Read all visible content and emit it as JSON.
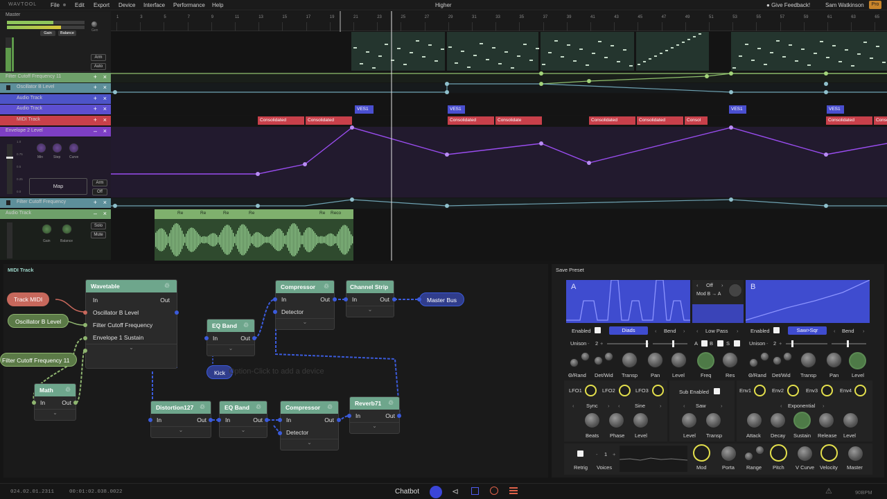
{
  "app": {
    "logo": "WAVTOOL",
    "title": "Higher",
    "feedback": "Give Feedback!",
    "user": "Sam Watkinson",
    "plan": "Pro"
  },
  "menu": [
    "File",
    "Edit",
    "Export",
    "Device",
    "Interface",
    "Performance",
    "Help"
  ],
  "ruler": [
    "1",
    "3",
    "5",
    "7",
    "9",
    "11",
    "13",
    "15",
    "17",
    "19",
    "21",
    "23",
    "25",
    "27",
    "29",
    "31",
    "33",
    "35",
    "37",
    "39",
    "41",
    "43",
    "45",
    "47",
    "49",
    "51",
    "53",
    "55",
    "57",
    "59",
    "61",
    "63",
    "65"
  ],
  "tracks": {
    "master": {
      "name": "Master",
      "knob1": "Gain",
      "knob2": "Balance",
      "knob3": "Gen",
      "arm": "Arm",
      "auto": "Auto"
    },
    "lanes": [
      {
        "name": "Filter Cutoff Frequency 11",
        "color": "#6ea06a"
      },
      {
        "name": "Oscillator B Level",
        "color": "#5d8f9a"
      },
      {
        "name": "Audio Track",
        "color": "#4d54c8"
      },
      {
        "name": "Audio Track",
        "color": "#5d4fd0"
      },
      {
        "name": "MIDI Track",
        "color": "#c8404a"
      }
    ],
    "envelope": {
      "name": "Envelope 2 Level",
      "k1": "Min",
      "k2": "Step",
      "k3": "Curve",
      "map": "Map",
      "arm": "Arm",
      "off": "Off",
      "scale": [
        "1.0",
        "0.75",
        "0.5",
        "0.25",
        "0.0"
      ]
    },
    "filter2": {
      "name": "Filter Cutoff Frequency"
    },
    "audio2": {
      "name": "Audio Track",
      "k1": "Gain",
      "k2": "Balance",
      "solo": "Solo",
      "mute": "Mute"
    }
  },
  "clips": {
    "ves": "VES1",
    "consolidated": "Consolidated",
    "consolidate": "Consolidate",
    "consol": "Consol",
    "re": "Re",
    "reco": "Reco"
  },
  "graph": {
    "title": "MIDI Track",
    "hint": "Option-Click to add a device",
    "pills": {
      "track_midi": "Track MIDI",
      "osc_b": "Oscillator B Level",
      "filter11": "Filter Cutoff Frequency 11",
      "master_bus": "Master Bus",
      "kick": "Kick"
    },
    "io": {
      "in": "In",
      "out": "Out",
      "detector": "Detector"
    },
    "wavetable": {
      "title": "Wavetable",
      "rows": [
        "Oscillator B Level",
        "Filter Cutoff Frequency",
        "Envelope 1 Sustain"
      ]
    },
    "nodes": {
      "compressor": "Compressor",
      "channel_strip": "Channel Strip",
      "eq_band": "EQ Band",
      "math": "Math",
      "distortion": "Distortion127",
      "reverb": "Reverb71"
    }
  },
  "synth": {
    "save_preset": "Save Preset",
    "osc_a": {
      "label": "A",
      "enabled": "Enabled",
      "wave": "Diads",
      "bend": "Bend",
      "unison": "Unison",
      "unison_val": "2",
      "knobs": [
        "Θ/Rand",
        "Det/Wid",
        "Transp",
        "Pan",
        "Level"
      ]
    },
    "filter": {
      "mode": "Off",
      "route": "Mod B → A",
      "type": "Low Pass",
      "a": "A",
      "b": "B",
      "s": "S",
      "knobs": [
        "Freq",
        "Res"
      ]
    },
    "osc_b": {
      "label": "B",
      "enabled": "Enabled",
      "wave": "Saw>Sqr",
      "bend": "Bend",
      "unison": "Unison",
      "unison_val": "2",
      "knobs": [
        "Θ/Rand",
        "Det/Wid",
        "Transp",
        "Pan",
        "Level"
      ]
    },
    "lfo": {
      "tabs": [
        "LFO1",
        "LFO2",
        "LFO3"
      ],
      "sync": "Sync",
      "shape": "Sine",
      "knobs": [
        "Beats",
        "Phase",
        "Level"
      ]
    },
    "sub": {
      "enabled": "Sub Enabled",
      "shape": "Saw",
      "knobs": [
        "Level",
        "Transp"
      ]
    },
    "env": {
      "tabs": [
        "Env1",
        "Env2",
        "Env3",
        "Env4"
      ],
      "curve": "Exponential",
      "knobs": [
        "Attack",
        "Decay",
        "Sustain",
        "Release",
        "Level"
      ]
    },
    "bottom": {
      "retrig": "Retrig",
      "voices": "Voices",
      "voices_val": "1",
      "knobs": [
        "Mod",
        "Porta",
        "Range",
        "Pitch",
        "V Curve",
        "Velocity",
        "Master"
      ]
    }
  },
  "status": {
    "position": "024.02.01.2311",
    "time": "00:01:02.038.0022",
    "chatbot": "Chatbot",
    "bpm": "90BPM"
  }
}
